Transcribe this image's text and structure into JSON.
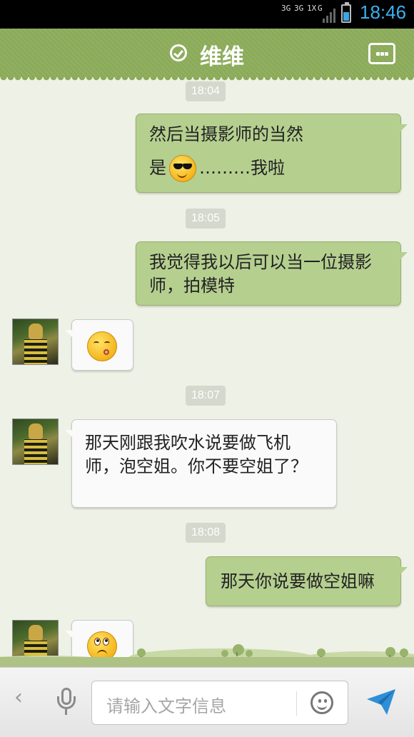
{
  "status_bar": {
    "network_1": "3G",
    "network_2": "3G",
    "network_3": "1X",
    "network_4": "G",
    "time": "18:46"
  },
  "header": {
    "title": "维维",
    "verified_icon": "check-circle-icon",
    "more_icon": "chat-more-icon"
  },
  "messages": [
    {
      "type": "time",
      "text": "18:04"
    },
    {
      "type": "sent",
      "line1": "然后当摄影师的当然",
      "line2_before": "是",
      "emoji": "sunglasses-emoji",
      "line2_after": "………我啦"
    },
    {
      "type": "time",
      "text": "18:05"
    },
    {
      "type": "sent",
      "text": "我觉得我以后可以当一位摄影师，拍模特"
    },
    {
      "type": "received",
      "emoji": "pout-kiss-emoji"
    },
    {
      "type": "time",
      "text": "18:07"
    },
    {
      "type": "received",
      "text": "那天刚跟我吹水说要做飞机师，泡空姐。你不要空姐了？"
    },
    {
      "type": "time",
      "text": "18:08"
    },
    {
      "type": "sent",
      "text": "那天你说要做空姐嘛"
    },
    {
      "type": "received",
      "emoji": "eye-roll-emoji"
    }
  ],
  "input_bar": {
    "back_icon": "chevron-left-icon",
    "back_glyph": "‹",
    "voice_icon": "microphone-icon",
    "placeholder": "请输入文字信息",
    "emoji_icon": "smiley-icon",
    "send_icon": "send-icon"
  },
  "colors": {
    "header": "#8bab59",
    "sent_bubble": "#b5cf8f",
    "received_bubble": "#fafafa",
    "background": "#eef1e6",
    "clock": "#3ab0ef"
  }
}
